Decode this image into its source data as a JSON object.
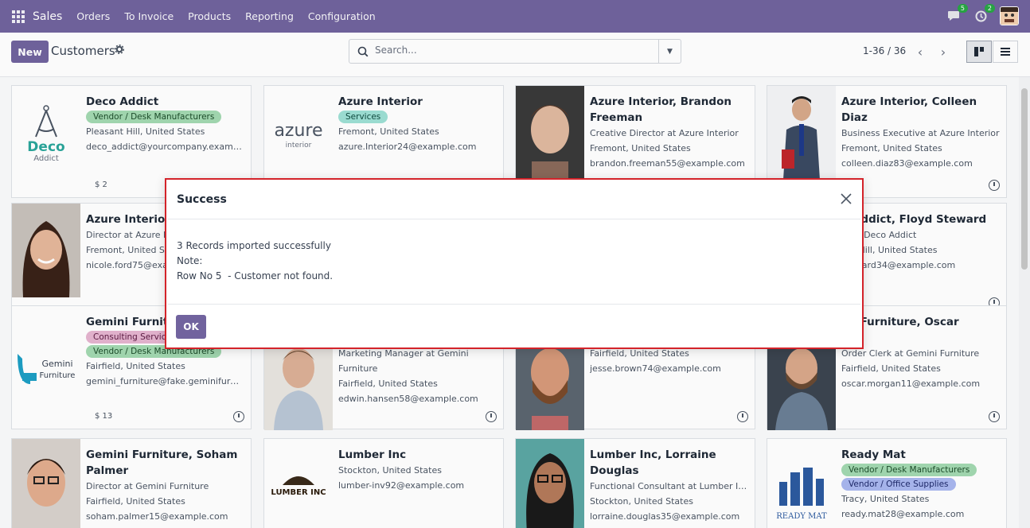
{
  "navbar": {
    "brand": "Sales",
    "menu": [
      "Orders",
      "To Invoice",
      "Products",
      "Reporting",
      "Configuration"
    ],
    "messages_badge": "5",
    "activities_badge": "2"
  },
  "control_panel": {
    "new_label": "New",
    "title": "Customers",
    "search_placeholder": "Search...",
    "pager": "1-36 / 36"
  },
  "cards": [
    {
      "name": "Deco Addict",
      "tags": [
        {
          "label": "Vendor / Desk Manufacturers",
          "color": "green"
        }
      ],
      "lines": [
        "Pleasant Hill, United States",
        "deco_addict@yourcompany.exampl..."
      ],
      "footer": "$ 2",
      "image": "logo-deco"
    },
    {
      "name": "Azure Interior",
      "tags": [
        {
          "label": "Services",
          "color": "teal"
        }
      ],
      "lines": [
        "Fremont, United States",
        "azure.Interior24@example.com"
      ],
      "footer": "",
      "image": "logo-azure"
    },
    {
      "name": "Azure Interior, Brandon Freeman",
      "tags": [],
      "lines": [
        "Creative Director at Azure Interior",
        "Fremont, United States",
        "brandon.freeman55@example.com"
      ],
      "footer": "",
      "image": "photo"
    },
    {
      "name": "Azure Interior, Colleen Diaz",
      "tags": [],
      "lines": [
        "Business Executive at Azure Interior",
        "Fremont, United States",
        "colleen.diaz83@example.com"
      ],
      "footer": "",
      "image": "photo"
    },
    {
      "name": "Azure Interior, N",
      "tags": [],
      "lines": [
        "Director at Azure I",
        "Fremont, United St",
        "nicole.ford75@exa"
      ],
      "footer": "",
      "image": "photo"
    },
    {
      "name": "",
      "tags": [],
      "lines": [],
      "footer": "",
      "image": "none"
    },
    {
      "name": "",
      "tags": [],
      "lines": [],
      "footer": "",
      "image": "none"
    },
    {
      "name": "o Addict, Floyd Steward",
      "tags": [],
      "lines": [
        "st at Deco Addict",
        "ant Hill, United States",
        "steward34@example.com"
      ],
      "footer": "",
      "image": "photo"
    },
    {
      "name": "Gemini Furnitu",
      "tags": [
        {
          "label": "Consulting Service",
          "color": "pink"
        },
        {
          "label": "Vendor / Desk Manufacturers",
          "color": "green"
        }
      ],
      "lines": [
        "Fairfield, United States",
        "gemini_furniture@fake.geminifurni..."
      ],
      "footer": "$ 13",
      "image": "logo-gemini"
    },
    {
      "name": "",
      "tags": [],
      "lines": [
        "Marketing Manager at Gemini",
        "Furniture",
        "Fairfield, United States",
        "edwin.hansen58@example.com"
      ],
      "footer": "",
      "image": "photo"
    },
    {
      "name": "",
      "tags": [],
      "lines": [
        "Fairfield, United States",
        "jesse.brown74@example.com"
      ],
      "footer": "",
      "image": "photo"
    },
    {
      "name": "ini Furniture, Oscar",
      "tags": [],
      "lines": [
        "gan",
        "Order Clerk at Gemini Furniture",
        "Fairfield, United States",
        "oscar.morgan11@example.com"
      ],
      "footer": "",
      "image": "photo"
    },
    {
      "name": "Gemini Furniture, Soham Palmer",
      "tags": [],
      "lines": [
        "Director at Gemini Furniture",
        "Fairfield, United States",
        "soham.palmer15@example.com"
      ],
      "footer": "",
      "image": "photo"
    },
    {
      "name": "Lumber Inc",
      "tags": [],
      "lines": [
        "Stockton, United States",
        "lumber-inv92@example.com"
      ],
      "footer": "",
      "image": "logo-lumber"
    },
    {
      "name": "Lumber Inc, Lorraine Douglas",
      "tags": [],
      "lines": [
        "Functional Consultant at Lumber Inc",
        "Stockton, United States",
        "lorraine.douglas35@example.com"
      ],
      "footer": "",
      "image": "photo"
    },
    {
      "name": "Ready Mat",
      "tags": [
        {
          "label": "Vendor / Desk Manufacturers",
          "color": "green"
        },
        {
          "label": "Vendor / Office Supplies",
          "color": "blue"
        }
      ],
      "lines": [
        "Tracy, United States",
        "ready.mat28@example.com"
      ],
      "footer": "",
      "image": "logo-readymat"
    }
  ],
  "logos": {
    "deco_line1": "Deco",
    "deco_line2": "Addict",
    "azure_line1": "azure",
    "azure_line2": "interior",
    "gemini_line1": "Gemini",
    "gemini_line2": "Furniture",
    "lumber": "LUMBER INC",
    "readymat": "READY MAT"
  },
  "modal": {
    "title": "Success",
    "line1": "3 Records imported successfully",
    "line2": "Note:",
    "line3": "Row No 5  - Customer not found.",
    "ok_label": "OK"
  },
  "colors": {
    "brand": "#71639e",
    "modal_border": "#d4232a"
  }
}
